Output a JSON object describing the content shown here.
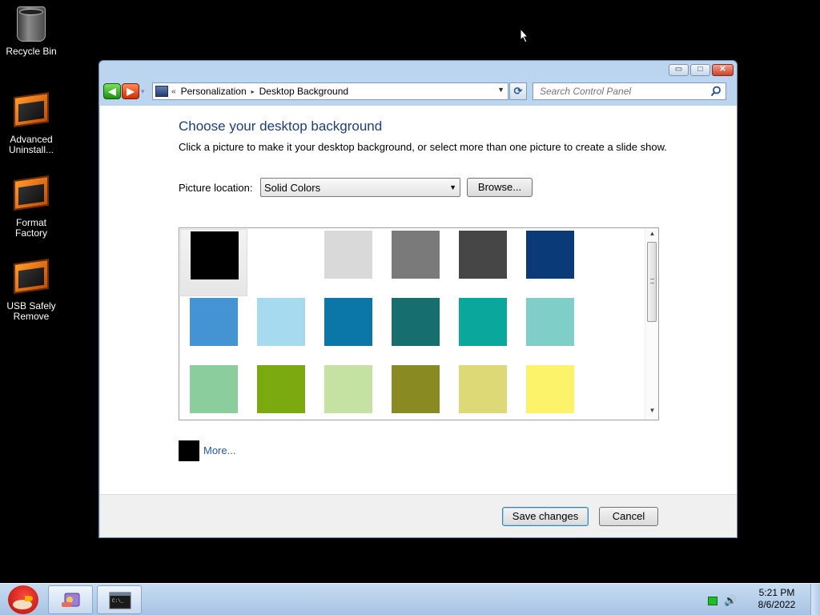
{
  "desktop": {
    "icons": [
      {
        "label": "Recycle Bin"
      },
      {
        "label": "Advanced Uninstall..."
      },
      {
        "label": "Format Factory"
      },
      {
        "label": "USB Safely Remove"
      }
    ]
  },
  "window": {
    "caption_buttons": {
      "minimize": "▭",
      "maximize": "□",
      "close": "✕"
    },
    "nav": {
      "back": "◀",
      "forward": "▶",
      "recent": "▾"
    },
    "breadcrumb": {
      "overflow": "«",
      "items": [
        "Personalization",
        "Desktop Background"
      ],
      "separator": "▸",
      "dropdown": "▼"
    },
    "refresh": "⟳",
    "search": {
      "placeholder": "Search Control Panel"
    },
    "heading": "Choose your desktop background",
    "description": "Click a picture to make it your desktop background, or select more than one picture to create a slide show.",
    "picture_location": {
      "label": "Picture location:",
      "value": "Solid Colors",
      "arrow": "▼"
    },
    "browse_label": "Browse...",
    "swatches": [
      {
        "color": "#000000",
        "selected": true
      },
      {
        "color": "#ffffff",
        "selected": false
      },
      {
        "color": "#d9d9d9",
        "selected": false
      },
      {
        "color": "#7a7a7a",
        "selected": false
      },
      {
        "color": "#464646",
        "selected": false
      },
      {
        "color": "#0b3a78",
        "selected": false
      },
      {
        "color": "#4494d4",
        "selected": false
      },
      {
        "color": "#a6dbef",
        "selected": false
      },
      {
        "color": "#0a77a8",
        "selected": false
      },
      {
        "color": "#166e6e",
        "selected": false
      },
      {
        "color": "#0aa89c",
        "selected": false
      },
      {
        "color": "#7fcfc8",
        "selected": false
      },
      {
        "color": "#8ccd9e",
        "selected": false
      },
      {
        "color": "#7aa910",
        "selected": false
      },
      {
        "color": "#c6e2a2",
        "selected": false
      },
      {
        "color": "#8a8a22",
        "selected": false
      },
      {
        "color": "#ddd976",
        "selected": false
      },
      {
        "color": "#fdf36a",
        "selected": false
      }
    ],
    "scroll": {
      "up": "▲",
      "down": "▼"
    },
    "more": {
      "label": "More...",
      "color": "#000000"
    },
    "save_label": "Save changes",
    "cancel_label": "Cancel"
  },
  "taskbar": {
    "clock": {
      "time": "5:21 PM",
      "date": "8/6/2022"
    },
    "volume_glyph": "🔊"
  },
  "colors": {
    "accent": "#1e3e78",
    "link": "#1e5aa8",
    "taskbar": "#b5cde9"
  }
}
